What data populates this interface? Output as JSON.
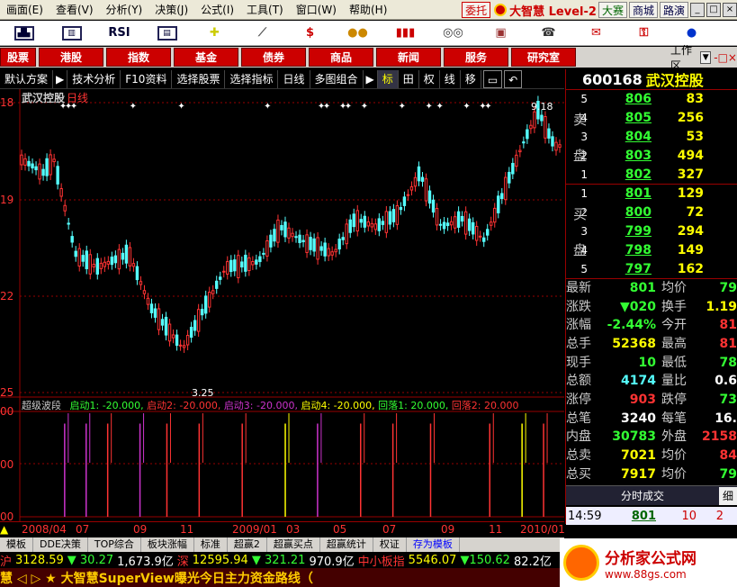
{
  "menu": [
    "画面(E)",
    "查看(V)",
    "分析(Y)",
    "决策(J)",
    "公式(I)",
    "工具(T)",
    "窗口(W)",
    "帮助(H)"
  ],
  "menu_right": {
    "wt": "委托",
    "brand": "大智慧 Level-2",
    "b1": "大赛",
    "b2": "商城",
    "b3": "路演"
  },
  "nav": [
    "股票",
    "港股",
    "指数",
    "基金",
    "债券",
    "商品",
    "新闻",
    "服务",
    "研究室"
  ],
  "workarea": "工作区",
  "subbar": [
    "默认方案",
    "技术分析",
    "F10资料",
    "选择股票",
    "选择指标",
    "日线",
    "多图组合",
    "标",
    "田",
    "权",
    "线",
    "移"
  ],
  "toolbar_icons": [
    "kline-icon",
    "chart-icon",
    "RSI",
    "monitor-icon",
    "move-icon",
    "ruler-icon",
    "dollar-icon",
    "traffic-light-icon",
    "bars-icon",
    "binoculars-icon",
    "book-icon",
    "phone-icon",
    "mail-icon",
    "lock-icon",
    "money-icon"
  ],
  "stock": {
    "code": "600168",
    "name": "武汉控股",
    "period": "日线"
  },
  "ask": [
    {
      "lvl": "5",
      "price": "806",
      "vol": "83"
    },
    {
      "lvl": "4",
      "price": "805",
      "vol": "256"
    },
    {
      "lvl": "3",
      "price": "804",
      "vol": "53"
    },
    {
      "lvl": "2",
      "price": "803",
      "vol": "494"
    },
    {
      "lvl": "1",
      "price": "802",
      "vol": "327"
    }
  ],
  "bid": [
    {
      "lvl": "1",
      "price": "801",
      "vol": "129"
    },
    {
      "lvl": "2",
      "price": "800",
      "vol": "72"
    },
    {
      "lvl": "3",
      "price": "799",
      "vol": "294"
    },
    {
      "lvl": "4",
      "price": "798",
      "vol": "149"
    },
    {
      "lvl": "5",
      "price": "797",
      "vol": "162"
    }
  ],
  "ask_label": [
    "卖",
    "盘"
  ],
  "bid_label": [
    "买",
    "盘"
  ],
  "stats": [
    [
      "最新",
      "801",
      "g",
      "均价",
      "79",
      "g"
    ],
    [
      "涨跌",
      "▼020",
      "g",
      "换手",
      "1.19",
      "y"
    ],
    [
      "涨幅",
      "-2.44%",
      "g",
      "今开",
      "81",
      "r"
    ],
    [
      "总手",
      "52368",
      "y",
      "最高",
      "81",
      "r"
    ],
    [
      "现手",
      "10",
      "g",
      "最低",
      "78",
      "g"
    ],
    [
      "总额",
      "4174",
      "c",
      "量比",
      "0.6",
      "w"
    ],
    [
      "涨停",
      "903",
      "r",
      "跌停",
      "73",
      "g"
    ],
    [
      "总笔",
      "3240",
      "w",
      "每笔",
      "16.",
      "w"
    ],
    [
      "内盘",
      "30783",
      "g",
      "外盘",
      "2158",
      "r"
    ],
    [
      "总卖",
      "7021",
      "y",
      "均价",
      "84",
      "r"
    ],
    [
      "总买",
      "7917",
      "y",
      "均价",
      "79",
      "g"
    ]
  ],
  "tick_header": "分时成交",
  "tick_header_btn": "细",
  "tick": {
    "time": "14:59",
    "price": "801",
    "vol": "10",
    "flag": "2"
  },
  "price_axis": [
    "18",
    "19",
    "22",
    "25"
  ],
  "sub_axis": [
    "00",
    "00",
    "00"
  ],
  "annot": {
    "high": "9.18",
    "low": "3.25"
  },
  "indicator": {
    "name": "超级波段",
    "items": [
      {
        "label": "启动1: -20.000,",
        "color": "#3f3"
      },
      {
        "label": "启动2: -20.000,",
        "color": "#f33"
      },
      {
        "label": "启动3: -20.000,",
        "color": "#c3c"
      },
      {
        "label": "启动4: -20.000,",
        "color": "#ff0"
      },
      {
        "label": "回落1: 20.000,",
        "color": "#3f3"
      },
      {
        "label": "回落2: 20.000",
        "color": "#f33"
      }
    ]
  },
  "dates": [
    "2008/04",
    "07",
    "09",
    "11",
    "2009/01",
    "03",
    "05",
    "07",
    "09",
    "11",
    "2010/01"
  ],
  "bottom_tabs": [
    "模板",
    "DDE决策",
    "TOP综合",
    "板块涨幅",
    "标准",
    "超赢2",
    "超赢买点",
    "超赢统计",
    "权证",
    "存为模板"
  ],
  "ticker": [
    {
      "t": "沪",
      "c": "#f33"
    },
    {
      "t": "3128.59",
      "c": "#ff0"
    },
    {
      "t": "▼ 30.27",
      "c": "#3f3"
    },
    {
      "t": "1,673.9亿",
      "c": "#fff"
    },
    {
      "t": "深",
      "c": "#f33"
    },
    {
      "t": "12595.94",
      "c": "#ff0"
    },
    {
      "t": "▼ 321.21",
      "c": "#3f3"
    },
    {
      "t": "970.9亿",
      "c": "#fff"
    },
    {
      "t": "中小板指",
      "c": "#f33"
    },
    {
      "t": "5546.07",
      "c": "#ff0"
    },
    {
      "t": "▼150.62",
      "c": "#3f3"
    },
    {
      "t": "82.2亿",
      "c": "#fff"
    }
  ],
  "scroll_text": "慧 ◁ ▷ ★ 大智慧SuperView曝光今日主力资金路线（",
  "logo": {
    "t1": "分析家公式网",
    "t2": "www.88gs.com"
  },
  "chart_data": {
    "type": "candlestick",
    "xlabel": "",
    "ylabel": "",
    "annotations": {
      "high": 9.18,
      "low": 3.25
    },
    "indicator_spikes": [
      {
        "x": 0.08,
        "h": 0.9,
        "color": "#c3c"
      },
      {
        "x": 0.12,
        "h": 0.9,
        "color": "#c3c"
      },
      {
        "x": 0.16,
        "h": 0.9,
        "color": "#f33"
      },
      {
        "x": 0.22,
        "h": 0.9,
        "color": "#c3c"
      },
      {
        "x": 0.27,
        "h": 0.9,
        "color": "#f33"
      },
      {
        "x": 0.33,
        "h": 0.9,
        "color": "#f33"
      },
      {
        "x": 0.41,
        "h": 0.9,
        "color": "#f33"
      },
      {
        "x": 0.49,
        "h": 0.9,
        "color": "#ff0"
      },
      {
        "x": 0.55,
        "h": 0.9,
        "color": "#c3c"
      },
      {
        "x": 0.63,
        "h": 0.9,
        "color": "#f33"
      },
      {
        "x": 0.69,
        "h": 0.9,
        "color": "#f33"
      },
      {
        "x": 0.76,
        "h": 0.9,
        "color": "#f33"
      },
      {
        "x": 0.87,
        "h": 0.9,
        "color": "#f33"
      },
      {
        "x": 0.93,
        "h": 0.9,
        "color": "#ff0"
      },
      {
        "x": 0.97,
        "h": 0.9,
        "color": "#f33"
      }
    ]
  }
}
